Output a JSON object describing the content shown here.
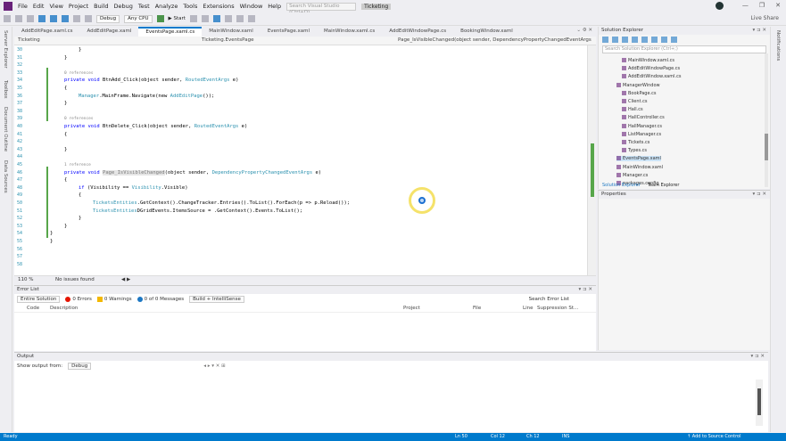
{
  "menu": {
    "items": [
      "File",
      "Edit",
      "View",
      "Project",
      "Build",
      "Debug",
      "Test",
      "Analyze",
      "Tools",
      "Extensions",
      "Window",
      "Help"
    ],
    "search_placeholder": "Search Visual Studio (Ctrl+Q)",
    "title": "Ticketing",
    "window_controls": [
      "—",
      "❐",
      "✕"
    ]
  },
  "toolbar": {
    "config": "Debug",
    "platform": "Any CPU",
    "start_label": "▶ Start",
    "live_share": "Live Share"
  },
  "left_strip": {
    "items": [
      "Server Explorer",
      "Toolbox",
      "Document Outline",
      "Data Sources"
    ]
  },
  "tabs": {
    "items": [
      "AddEditPage.xaml.cs",
      "AddEditPage.xaml",
      "EventsPage.xaml.cs",
      "MainWindow.xaml",
      "EventsPage.xaml",
      "MainWindow.xaml.cs",
      "AddEditWindowPage.cs",
      "BookingWindow.xaml"
    ],
    "active_index": 2,
    "controls": "⌄ ⚙ ✕"
  },
  "navbar": {
    "project": "Ticketing",
    "class": "Ticketing.EventsPage",
    "member": "Page_IsVisibleChanged(object sender, DependencyPropertyChangedEventArgs e)"
  },
  "editor": {
    "line_numbers": [
      "30",
      "31",
      "32",
      "33",
      "34",
      "35",
      "36",
      "37",
      "38",
      "39",
      "40",
      "41",
      "42",
      "43",
      "44",
      "45",
      "46",
      "47",
      "48",
      "49",
      "50",
      "51",
      "52",
      "53",
      "54",
      "55",
      "56",
      "57",
      "58"
    ],
    "lines": [
      {
        "indent": 2,
        "text": "}"
      },
      {
        "indent": 1,
        "text": "}"
      },
      {
        "indent": 0,
        "text": ""
      },
      {
        "indent": 1,
        "ref": "0 references"
      },
      {
        "indent": 1,
        "kw": "private void ",
        "name": "BtnAdd_Click",
        "rest": "(object sender, ",
        "ty": "RoutedEventArgs",
        "tail": " e)"
      },
      {
        "indent": 1,
        "text": "{"
      },
      {
        "indent": 2,
        "ty": "Manager",
        "rest": ".MainFrame.Navigate(new ",
        "ty2": "AddEditPage",
        "tail": "());"
      },
      {
        "indent": 1,
        "text": "}"
      },
      {
        "indent": 0,
        "text": ""
      },
      {
        "indent": 1,
        "ref": "0 references"
      },
      {
        "indent": 1,
        "kw": "private void ",
        "name": "BtnDelete_Click",
        "rest": "(object sender, ",
        "ty": "RoutedEventArgs",
        "tail": " e)"
      },
      {
        "indent": 1,
        "text": "{"
      },
      {
        "indent": 0,
        "text": ""
      },
      {
        "indent": 1,
        "text": "}"
      },
      {
        "indent": 0,
        "text": ""
      },
      {
        "indent": 1,
        "ref": "1 reference"
      },
      {
        "indent": 1,
        "kw": "private void ",
        "hl": "Page_IsVisibleChanged",
        "rest": "(object sender, ",
        "ty": "DependencyPropertyChangedEventArgs",
        "tail": " e)"
      },
      {
        "indent": 1,
        "text": "{"
      },
      {
        "indent": 2,
        "kw": "if ",
        "rest": "(Visibility == ",
        "ty": "Visibility",
        "tail": ".Visible)"
      },
      {
        "indent": 2,
        "text": "{"
      },
      {
        "indent": 3,
        "ty": "TicketsEntities",
        "rest": ".GetContext().ChangeTracker.Entries().ToList().ForEach(p => p.Reload());"
      },
      {
        "indent": 3,
        "rest": "DGridEvents.ItemsSource = ",
        "ty": "TicketsEntities",
        "tail": ".GetContext().Events.ToList();"
      },
      {
        "indent": 2,
        "text": "}"
      },
      {
        "indent": 1,
        "text": "}"
      },
      {
        "indent": 0,
        "text": "}"
      },
      {
        "indent": 0,
        "text": "}"
      },
      {
        "indent": 0,
        "text": ""
      },
      {
        "indent": 0,
        "text": ""
      },
      {
        "indent": 0,
        "text": ""
      }
    ]
  },
  "editor_status": {
    "zoom": "110 %",
    "issues": "No issues found",
    "nav": "◀ ▶"
  },
  "error_list": {
    "title": "Error List",
    "scope": "Entire Solution",
    "errors": "0 Errors",
    "warnings": "0 Warnings",
    "messages": "0 of 0 Messages",
    "build_filter": "Build + IntelliSense",
    "search_placeholder": "Search Error List",
    "columns": [
      "Code",
      "Description",
      "Project",
      "File",
      "Line",
      "Suppression St..."
    ],
    "controls": "▾ ⊐ ✕"
  },
  "output": {
    "title": "Output",
    "source_label": "Show output from:",
    "source_value": "Debug",
    "controls": "▾ ⊐ ✕"
  },
  "solution_explorer": {
    "title": "Solution Explorer",
    "search_placeholder": "Search Solution Explorer (Ctrl+;)",
    "items": [
      {
        "depth": 2,
        "label": "MainWindow.xaml.cs"
      },
      {
        "depth": 2,
        "label": "AddEditWindowPage.cs"
      },
      {
        "depth": 2,
        "label": "AddEditWindow.xaml.cs"
      },
      {
        "depth": 1,
        "label": "ManagerWindow"
      },
      {
        "depth": 2,
        "label": "BookPage.cs"
      },
      {
        "depth": 2,
        "label": "Client.cs"
      },
      {
        "depth": 2,
        "label": "Hall.cs"
      },
      {
        "depth": 2,
        "label": "HallController.cs"
      },
      {
        "depth": 2,
        "label": "HallManager.cs"
      },
      {
        "depth": 2,
        "label": "ListManager.cs"
      },
      {
        "depth": 2,
        "label": "Tickets.cs"
      },
      {
        "depth": 2,
        "label": "Types.cs"
      },
      {
        "depth": 1,
        "label": "EventsPage.xaml",
        "selected": true
      },
      {
        "depth": 1,
        "label": "MainWindow.xaml"
      },
      {
        "depth": 1,
        "label": "Manager.cs"
      },
      {
        "depth": 1,
        "label": "packages.config"
      }
    ],
    "tabs": [
      "Solution Explorer",
      "Team Explorer"
    ]
  },
  "properties": {
    "title": "Properties",
    "controls": "▾ ⊐ ✕"
  },
  "right_strip": {
    "label": "Notifications"
  },
  "statusbar": {
    "left": "Ready",
    "ln": "Ln 50",
    "col": "Col 12",
    "ch": "Ch 12",
    "ins": "INS",
    "source_control": "↑ Add to Source Control"
  }
}
